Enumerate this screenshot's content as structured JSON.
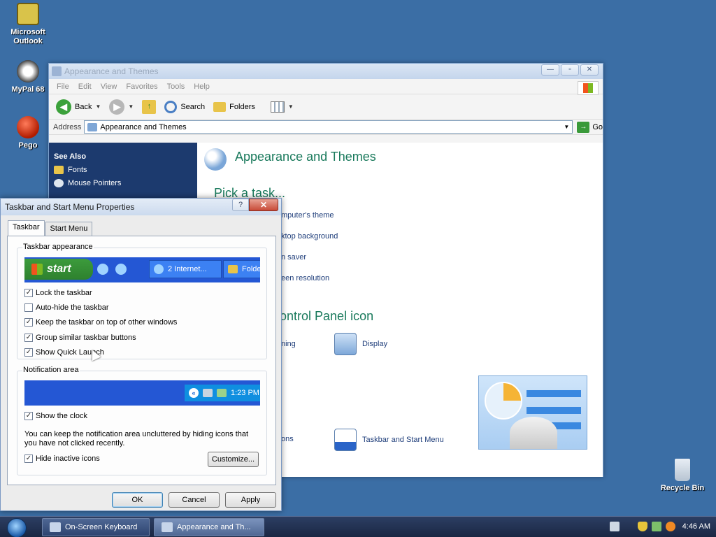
{
  "desktop": {
    "icons": [
      {
        "label": "Microsoft Outlook"
      },
      {
        "label": "MyPal 68"
      },
      {
        "label": "Pego"
      },
      {
        "label": "Recycle Bin"
      }
    ]
  },
  "explorer": {
    "title": "Appearance and Themes",
    "menu": [
      "File",
      "Edit",
      "View",
      "Favorites",
      "Tools",
      "Help"
    ],
    "toolbar": {
      "back": "Back",
      "search": "Search",
      "folders": "Folders"
    },
    "address": {
      "label": "Address",
      "value": "Appearance and Themes",
      "go": "Go"
    },
    "sidebar": {
      "heading": "See Also",
      "links": [
        "Fonts",
        "Mouse Pointers"
      ]
    },
    "main": {
      "heading": "Appearance and Themes",
      "pick_task": "Pick a task...",
      "tasks": [
        "mputer's theme",
        "ktop background",
        "n saver",
        "een resolution"
      ],
      "cp_heading": "ontrol Panel icon",
      "cp_items": [
        "ning",
        "Display",
        "ons",
        "Taskbar and Start Menu"
      ]
    }
  },
  "dialog": {
    "title": "Taskbar and Start Menu Properties",
    "help": "?",
    "close": "✕",
    "tabs": [
      "Taskbar",
      "Start Menu"
    ],
    "taskbar_appearance": {
      "label": "Taskbar appearance",
      "preview": {
        "start": "start",
        "button1": "2 Internet...",
        "button2": "Folde"
      },
      "options": [
        {
          "label": "Lock the taskbar",
          "checked": true
        },
        {
          "label": "Auto-hide the taskbar",
          "checked": false
        },
        {
          "label": "Keep the taskbar on top of other windows",
          "checked": true
        },
        {
          "label": "Group similar taskbar buttons",
          "checked": true
        },
        {
          "label": "Show Quick Launch",
          "checked": true
        }
      ]
    },
    "notification_area": {
      "label": "Notification area",
      "clock": "1:23 PM",
      "show_clock": {
        "label": "Show the clock",
        "checked": true
      },
      "description": "You can keep the notification area uncluttered by hiding icons that you have not clicked recently.",
      "hide_inactive": {
        "label": "Hide inactive icons",
        "checked": true
      },
      "customize": "Customize..."
    },
    "buttons": {
      "ok": "OK",
      "cancel": "Cancel",
      "apply": "Apply"
    }
  },
  "taskbar": {
    "items": [
      "On-Screen Keyboard",
      "Appearance and Th..."
    ],
    "clock": "4:46 AM"
  }
}
